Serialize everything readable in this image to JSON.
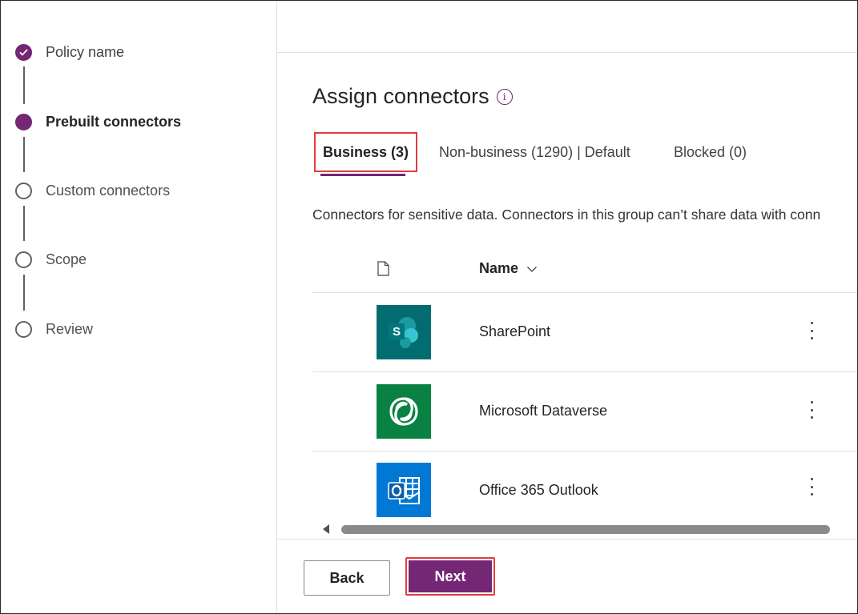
{
  "stepper": {
    "steps": [
      {
        "label": "Policy name",
        "state": "done"
      },
      {
        "label": "Prebuilt connectors",
        "state": "current"
      },
      {
        "label": "Custom connectors",
        "state": "upcoming"
      },
      {
        "label": "Scope",
        "state": "upcoming"
      },
      {
        "label": "Review",
        "state": "upcoming"
      }
    ]
  },
  "main": {
    "heading": "Assign connectors",
    "info_icon": "i",
    "tabs": [
      {
        "label": "Business (3)",
        "active": true
      },
      {
        "label": "Non-business (1290) | Default",
        "active": false
      },
      {
        "label": "Blocked (0)",
        "active": false
      }
    ],
    "description": "Connectors for sensitive data. Connectors in this group can’t share data with conn",
    "table": {
      "columns": {
        "icon": "file-icon",
        "name": "Name"
      },
      "rows": [
        {
          "name": "SharePoint",
          "icon": "sharepoint-logo",
          "color": "#036c70"
        },
        {
          "name": "Microsoft Dataverse",
          "icon": "dataverse-logo",
          "color": "#088142"
        },
        {
          "name": "Office 365 Outlook",
          "icon": "outlook-logo",
          "color": "#0078d4"
        }
      ]
    }
  },
  "footer": {
    "back_label": "Back",
    "next_label": "Next"
  },
  "colors": {
    "accent": "#742774",
    "highlight": "#e33b3b"
  }
}
